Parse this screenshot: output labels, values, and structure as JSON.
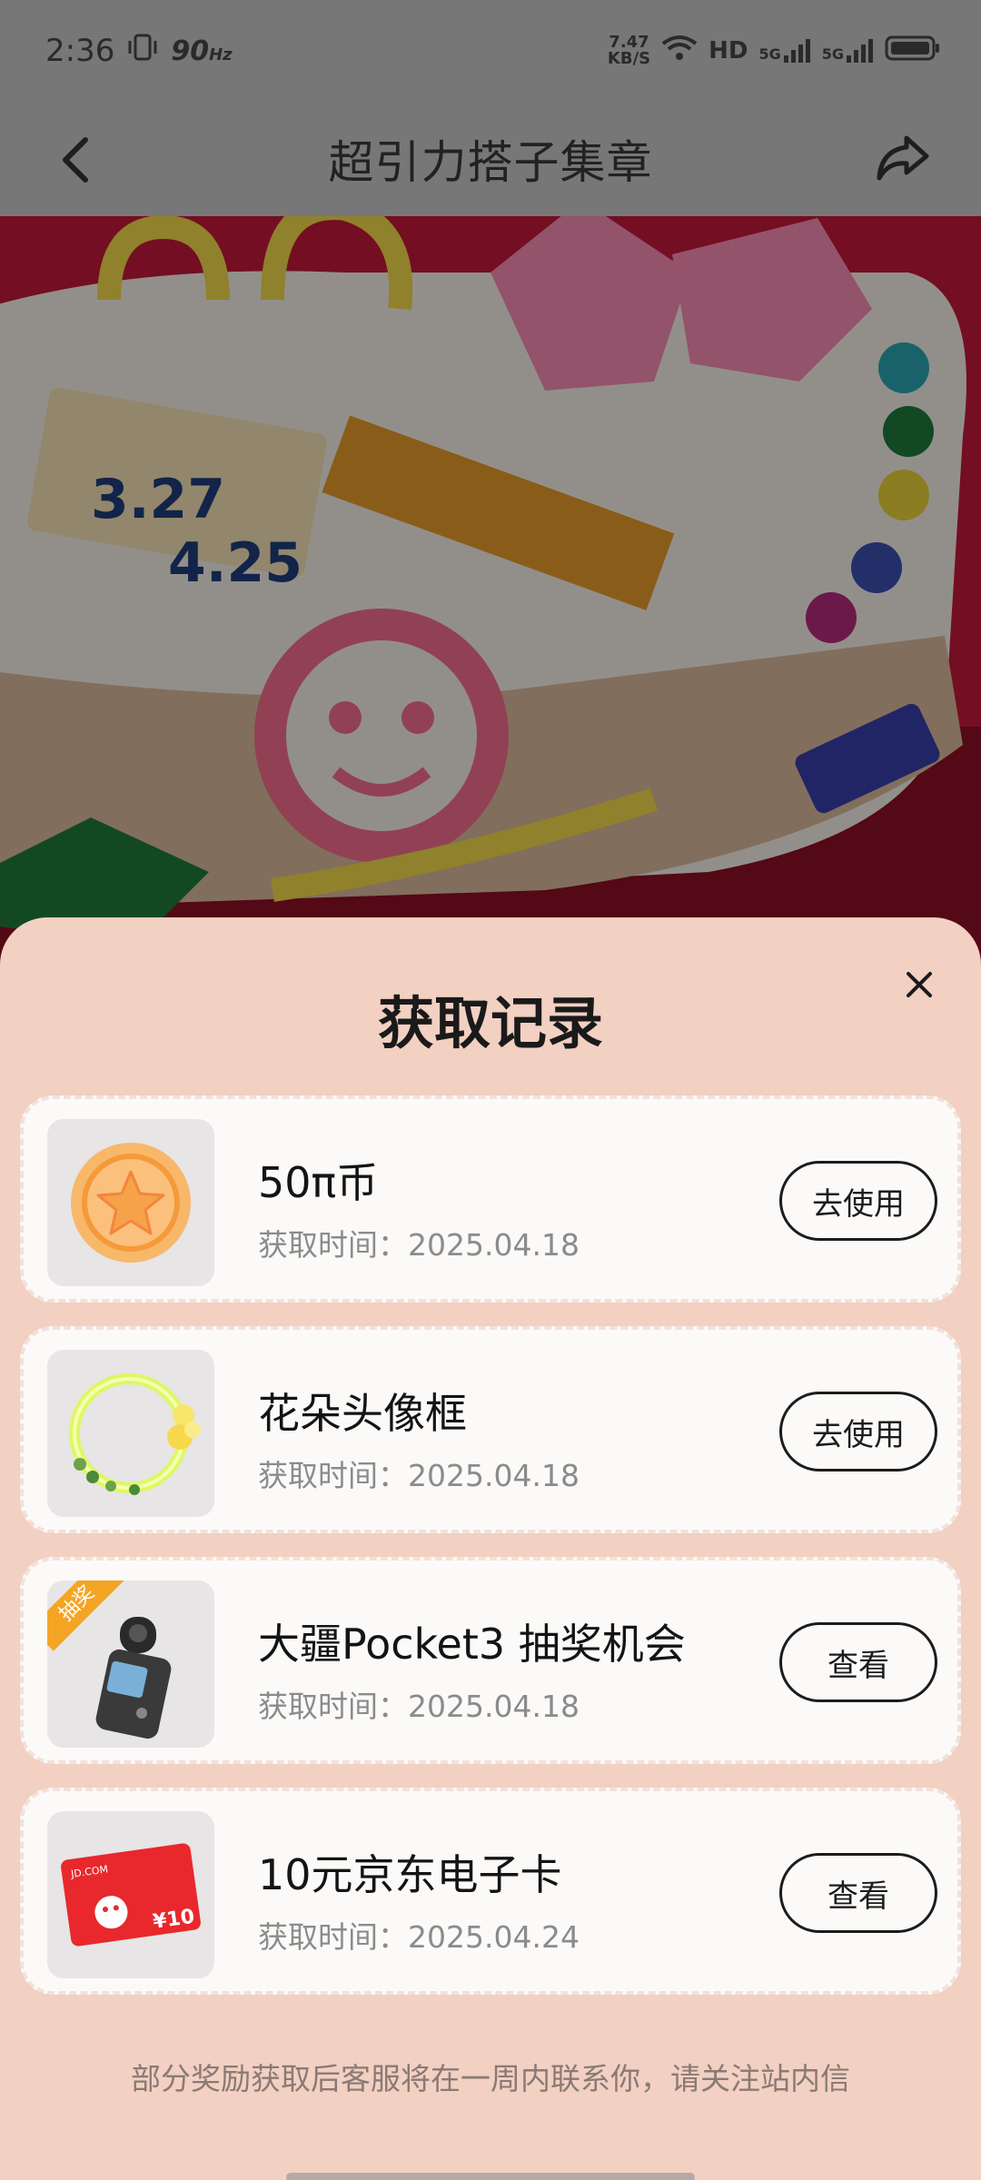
{
  "status_bar": {
    "time": "2:36",
    "refresh_rate": "90",
    "refresh_unit": "Hz",
    "speed_value": "7.47",
    "speed_unit": "KB/S",
    "hd": "HD",
    "network": "5G"
  },
  "nav": {
    "title": "超引力搭子集章"
  },
  "banner": {
    "date_line1": "3.27",
    "date_line2": "4.25"
  },
  "sheet": {
    "title": "获取记录",
    "items": [
      {
        "name": "50π币",
        "time": "获取时间：2025.04.18",
        "action": "去使用",
        "thumb": "coin-icon"
      },
      {
        "name": "花朵头像框",
        "time": "获取时间：2025.04.18",
        "action": "去使用",
        "thumb": "flower-frame-icon"
      },
      {
        "name": "大疆Pocket3 抽奖机会",
        "time": "获取时间：2025.04.18",
        "action": "查看",
        "thumb": "camera-icon",
        "badge": "抽奖"
      },
      {
        "name": "10元京东电子卡",
        "time": "获取时间：2025.04.24",
        "action": "查看",
        "thumb": "gift-card-icon",
        "card_brand": "JD.COM",
        "card_value": "¥10"
      }
    ],
    "footnote": "部分奖励获取后客服将在一周内联系你，请关注站内信"
  },
  "colors": {
    "sheet_bg": "#f2d0c2",
    "card_bg": "#fcfaf8",
    "banner_red": "#c61c3b"
  }
}
